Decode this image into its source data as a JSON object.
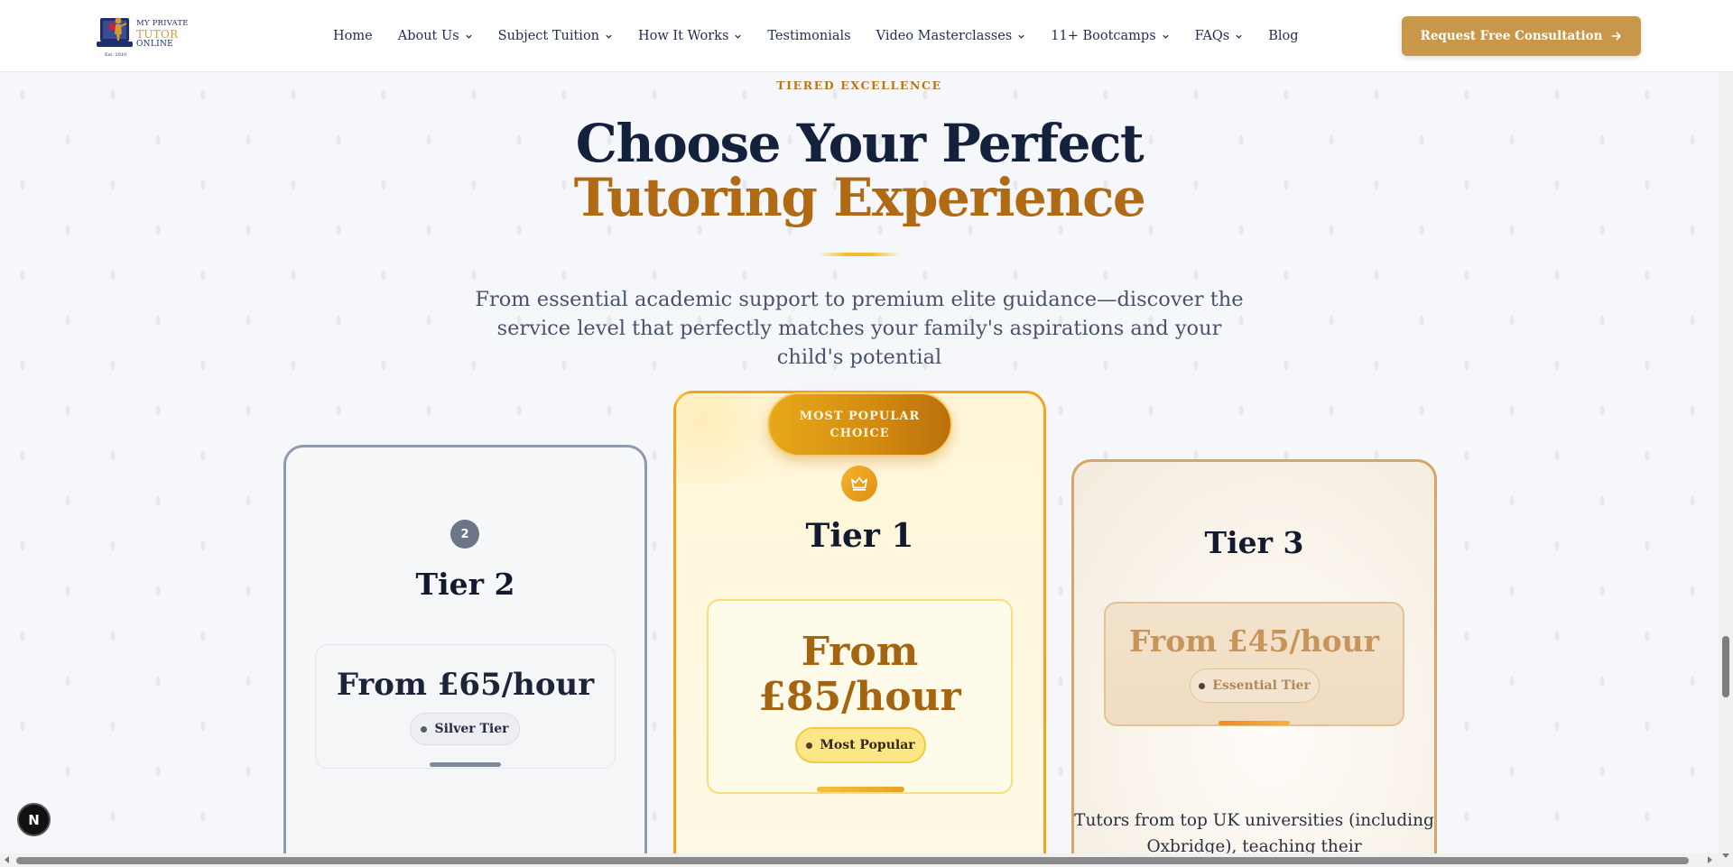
{
  "logo": {
    "line1": "MY PRIVATE",
    "line2": "TUTOR",
    "line3": "ONLINE",
    "est": "Est. 2010"
  },
  "nav": {
    "items": [
      {
        "label": "Home",
        "dropdown": false
      },
      {
        "label": "About Us",
        "dropdown": true
      },
      {
        "label": "Subject Tuition",
        "dropdown": true
      },
      {
        "label": "How It Works",
        "dropdown": true
      },
      {
        "label": "Testimonials",
        "dropdown": false
      },
      {
        "label": "Video Masterclasses",
        "dropdown": true
      },
      {
        "label": "11+ Bootcamps",
        "dropdown": true
      },
      {
        "label": "FAQs",
        "dropdown": true
      },
      {
        "label": "Blog",
        "dropdown": false
      }
    ],
    "cta_label": "Request Free Consultation",
    "cta_icon": "arrow-right-icon"
  },
  "section": {
    "eyebrow": "TIERED EXCELLENCE",
    "title_line1": "Choose Your Perfect",
    "title_line2": "Tutoring Experience",
    "subtitle": "From essential academic support to premium elite guidance—discover the service level that perfectly matches your family's aspirations and your child's potential"
  },
  "tiers": [
    {
      "number": "2",
      "name": "Tier 2",
      "price": "From £65/hour",
      "pill": "Silver Tier"
    },
    {
      "badge": "MOST POPULAR CHOICE",
      "icon": "crown-icon",
      "name": "Tier 1",
      "price_line1": "From",
      "price_line2": "£85/hour",
      "pill": "Most Popular"
    },
    {
      "name": "Tier 3",
      "price": "From £45/hour",
      "pill": "Essential Tier",
      "description": "Tutors from top UK universities (including Oxbridge), teaching their"
    }
  ],
  "floating_button": "N",
  "colors": {
    "gold_accent": "#c9974a",
    "title_gold": "#b06a14",
    "navy": "#14213d",
    "tier1_border": "#f0a51d",
    "tier2_border": "#8c9bb0",
    "tier3_border": "#d3a867"
  }
}
